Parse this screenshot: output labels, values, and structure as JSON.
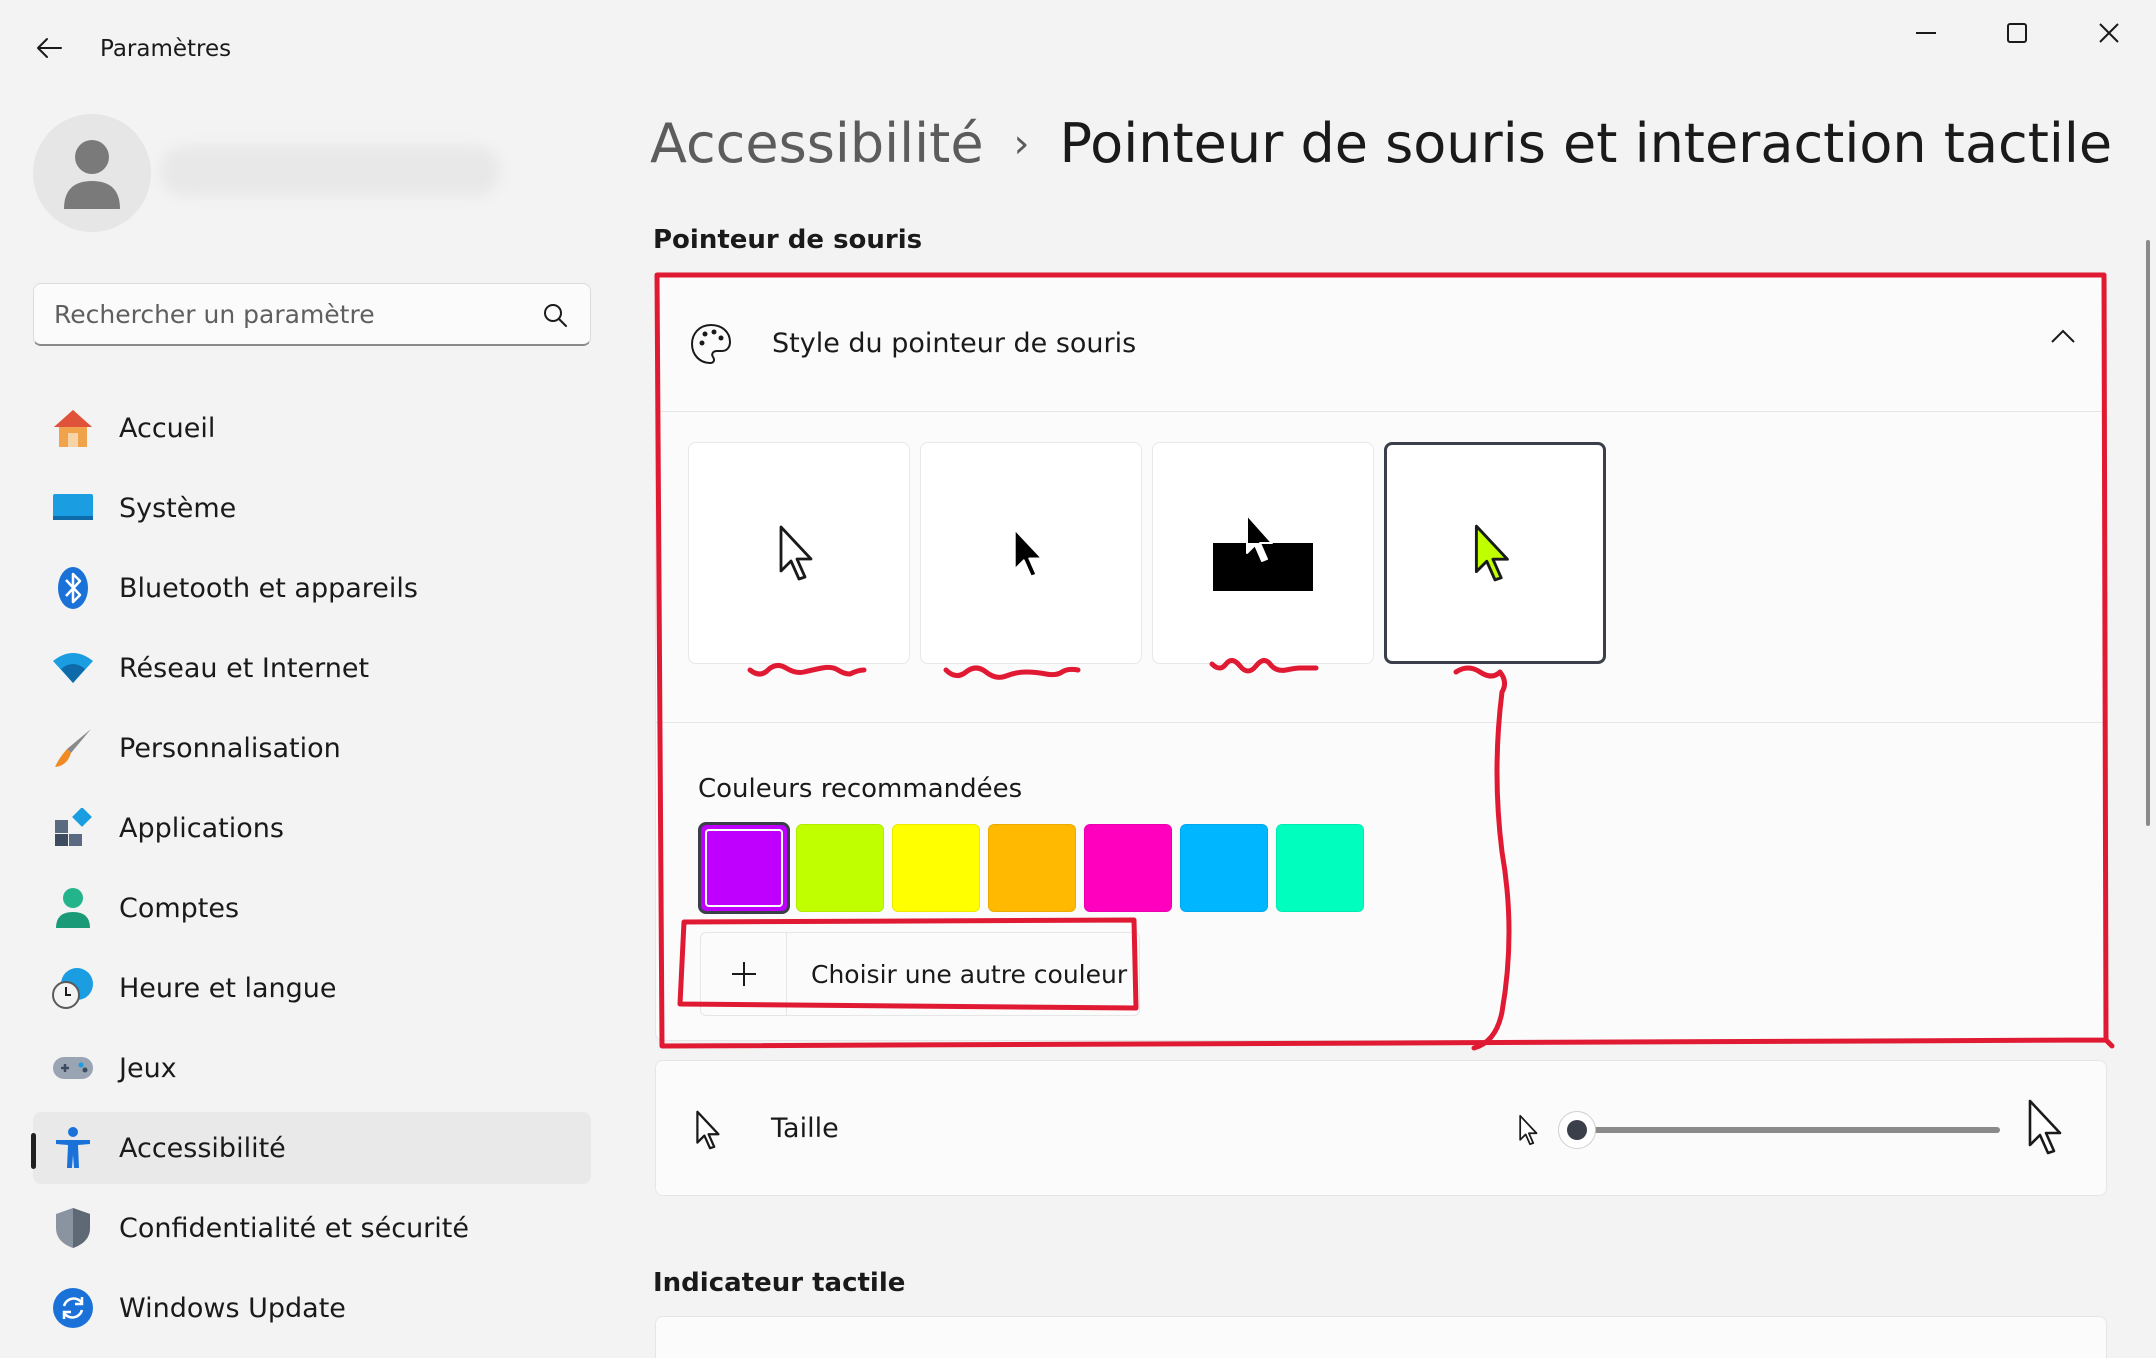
{
  "window": {
    "title": "Paramètres"
  },
  "search": {
    "placeholder": "Rechercher un paramètre"
  },
  "sidebar": {
    "items": [
      {
        "label": "Accueil",
        "icon": "home-icon"
      },
      {
        "label": "Système",
        "icon": "system-icon"
      },
      {
        "label": "Bluetooth et appareils",
        "icon": "bluetooth-icon"
      },
      {
        "label": "Réseau et Internet",
        "icon": "wifi-icon"
      },
      {
        "label": "Personnalisation",
        "icon": "brush-icon"
      },
      {
        "label": "Applications",
        "icon": "apps-icon"
      },
      {
        "label": "Comptes",
        "icon": "account-icon"
      },
      {
        "label": "Heure et langue",
        "icon": "clock-globe-icon"
      },
      {
        "label": "Jeux",
        "icon": "gamepad-icon"
      },
      {
        "label": "Accessibilité",
        "icon": "accessibility-icon",
        "active": true
      },
      {
        "label": "Confidentialité et sécurité",
        "icon": "shield-icon"
      },
      {
        "label": "Windows Update",
        "icon": "update-icon"
      }
    ]
  },
  "header": {
    "breadcrumb_parent": "Accessibilité",
    "breadcrumb_separator": "›",
    "breadcrumb_current": "Pointeur de souris et interaction tactile"
  },
  "mouse_section": {
    "title": "Pointeur de souris",
    "style_card": {
      "title": "Style du pointeur de souris",
      "expanded": true,
      "styles": [
        {
          "name": "white",
          "selected": false
        },
        {
          "name": "black",
          "selected": false
        },
        {
          "name": "inverted",
          "selected": false
        },
        {
          "name": "custom",
          "selected": true,
          "color": "#bfff00"
        }
      ],
      "colors_label": "Couleurs recommandées",
      "colors": [
        {
          "hex": "#bf00ff",
          "selected": true
        },
        {
          "hex": "#bfff00",
          "selected": false
        },
        {
          "hex": "#ffff00",
          "selected": false
        },
        {
          "hex": "#ffb900",
          "selected": false
        },
        {
          "hex": "#ff00bf",
          "selected": false
        },
        {
          "hex": "#00b7ff",
          "selected": false
        },
        {
          "hex": "#00ffbf",
          "selected": false
        }
      ],
      "custom_color_label": "Choisir une autre couleur"
    },
    "size_card": {
      "title": "Taille",
      "value": 1,
      "min": 1,
      "max": 15
    }
  },
  "touch_section": {
    "title": "Indicateur tactile"
  },
  "colors": {
    "annotation": "#e01a33",
    "accent_dark": "#3a3f4a"
  }
}
